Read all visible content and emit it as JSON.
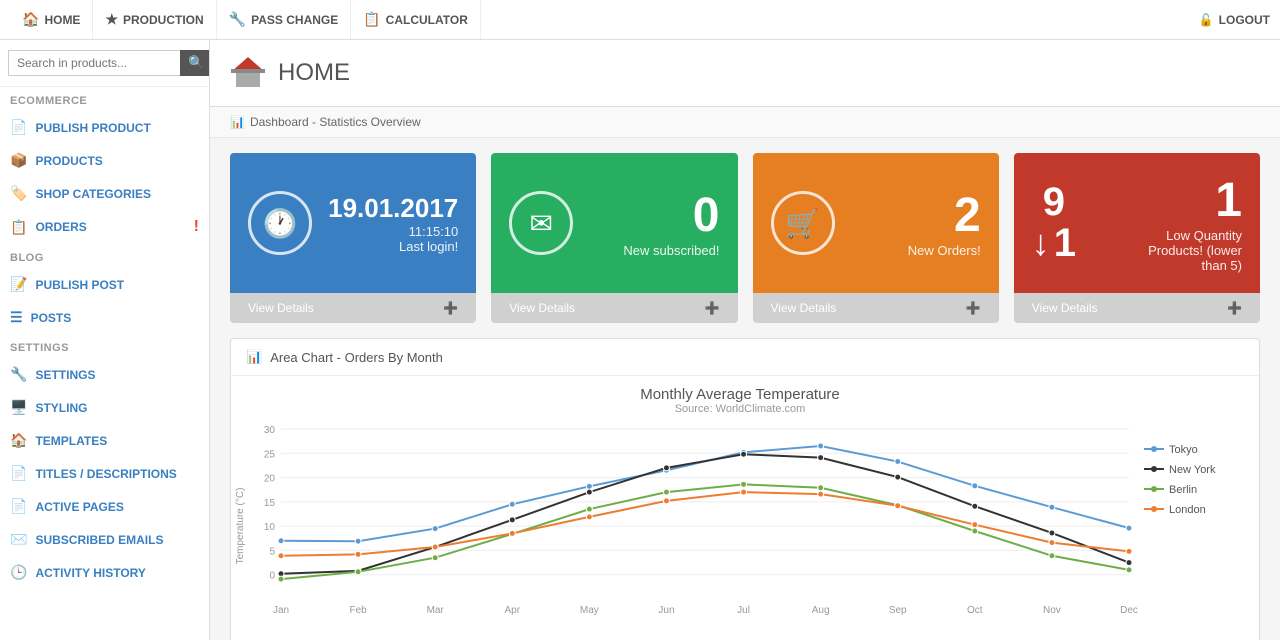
{
  "nav": {
    "items": [
      {
        "id": "home",
        "label": "HOME",
        "icon": "🏠"
      },
      {
        "id": "production",
        "label": "PRODUCTION",
        "icon": "★"
      },
      {
        "id": "pass-change",
        "label": "PASS CHANGE",
        "icon": "🔧"
      },
      {
        "id": "calculator",
        "label": "CALCULATOR",
        "icon": "📋"
      }
    ],
    "logout_label": "LOGOUT",
    "logout_icon": "🔓"
  },
  "sidebar": {
    "search_placeholder": "Search in products...",
    "sections": [
      {
        "label": "ECOMMERCE",
        "items": [
          {
            "id": "publish-product",
            "label": "PUBLISH PRODUCT",
            "icon": "📄",
            "badge": null
          },
          {
            "id": "products",
            "label": "PRODUCTS",
            "icon": "📦",
            "badge": null
          },
          {
            "id": "shop-categories",
            "label": "SHOP CATEGORIES",
            "icon": "🏷️",
            "badge": null
          },
          {
            "id": "orders",
            "label": "ORDERS",
            "icon": "📋",
            "badge": "!"
          }
        ]
      },
      {
        "label": "BLOG",
        "items": [
          {
            "id": "publish-post",
            "label": "PUBLISH POST",
            "icon": "📝",
            "badge": null
          },
          {
            "id": "posts",
            "label": "POSTS",
            "icon": "☰",
            "badge": null
          }
        ]
      },
      {
        "label": "SETTINGS",
        "items": [
          {
            "id": "settings",
            "label": "SETTINGS",
            "icon": "🔧",
            "badge": null
          },
          {
            "id": "styling",
            "label": "STYLING",
            "icon": "🖥️",
            "badge": null
          },
          {
            "id": "templates",
            "label": "TEMPLATES",
            "icon": "🏠",
            "badge": null
          },
          {
            "id": "titles-descriptions",
            "label": "TITLES / DESCRIPTIONS",
            "icon": "📄",
            "badge": null
          },
          {
            "id": "active-pages",
            "label": "ACTIVE PAGES",
            "icon": "📄",
            "badge": null
          },
          {
            "id": "subscribed-emails",
            "label": "SUBSCRIBED EMAILS",
            "icon": "✉️",
            "badge": null
          },
          {
            "id": "activity-history",
            "label": "ACTIVITY HISTORY",
            "icon": "🕒",
            "badge": null
          }
        ]
      }
    ]
  },
  "page": {
    "title": "HOME",
    "breadcrumb": "Dashboard - Statistics Overview"
  },
  "stats": {
    "cards": [
      {
        "id": "last-login",
        "color": "card-blue",
        "date": "19.01.2017",
        "time": "11:15:10",
        "label": "Last login!",
        "footer": "View Details",
        "type": "date"
      },
      {
        "id": "new-subscribed",
        "color": "card-green",
        "number": "0",
        "label": "New subscribed!",
        "footer": "View Details",
        "icon": "✉",
        "type": "number"
      },
      {
        "id": "new-orders",
        "color": "card-orange",
        "number": "2",
        "label": "New Orders!",
        "footer": "View Details",
        "icon": "🛒",
        "type": "number"
      },
      {
        "id": "low-quantity",
        "color": "card-red",
        "number": "1",
        "numbers_top": "9",
        "numbers_bottom": "1",
        "label": "Low Quantity Products! (lower than 5)",
        "footer": "View Details",
        "type": "low-quantity"
      }
    ]
  },
  "chart": {
    "section_title": "Area Chart - Orders By Month",
    "title": "Monthly Average Temperature",
    "subtitle": "Source: WorldClimate.com",
    "y_label": "Temperature (°C)",
    "y_ticks": [
      0,
      5,
      10,
      15,
      20,
      25,
      30
    ],
    "legend": [
      {
        "name": "Tokyo",
        "color": "#5b9bd5"
      },
      {
        "name": "New York",
        "color": "#333"
      },
      {
        "name": "Berlin",
        "color": "#70ad47"
      },
      {
        "name": "London",
        "color": "#ed7d31"
      }
    ],
    "series": {
      "tokyo": [
        7,
        6.9,
        9.5,
        14.5,
        18.2,
        21.5,
        25.2,
        26.5,
        23.3,
        18.3,
        13.9,
        9.6
      ],
      "new_york": [
        0.2,
        0.8,
        5.7,
        11.3,
        17.0,
        22.0,
        24.8,
        24.1,
        20.1,
        14.1,
        8.6,
        2.5
      ],
      "berlin": [
        -0.9,
        0.6,
        3.5,
        8.4,
        13.5,
        17.0,
        18.6,
        17.9,
        14.3,
        9.0,
        3.9,
        1.0
      ],
      "london": [
        3.9,
        4.2,
        5.7,
        8.5,
        11.9,
        15.2,
        17.0,
        16.6,
        14.2,
        10.3,
        6.6,
        4.8
      ]
    }
  }
}
